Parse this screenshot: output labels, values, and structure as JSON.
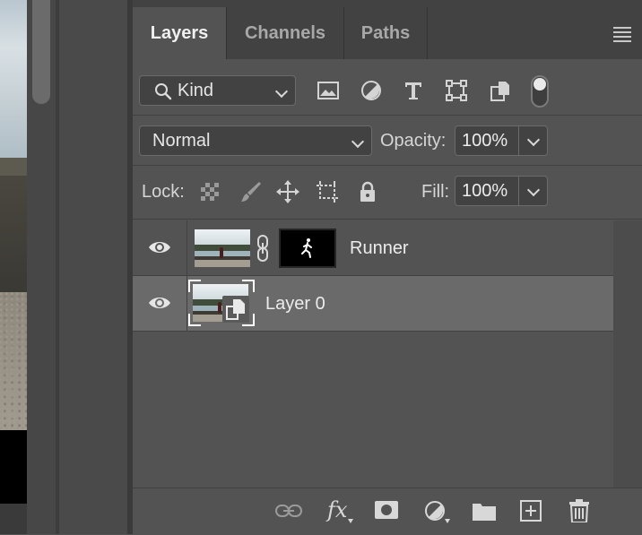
{
  "tabs": [
    {
      "label": "Layers",
      "active": true
    },
    {
      "label": "Channels",
      "active": false
    },
    {
      "label": "Paths",
      "active": false
    }
  ],
  "filter": {
    "kind_label": "Kind",
    "icons": [
      "image-filter-icon",
      "adjustment-filter-icon",
      "type-filter-icon",
      "shape-filter-icon",
      "smart-object-filter-icon"
    ],
    "toggle_on": true
  },
  "blend": {
    "mode": "Normal",
    "opacity_label": "Opacity:",
    "opacity_value": "100%"
  },
  "lock": {
    "label": "Lock:",
    "icons": [
      "lock-transparent-pixels-icon",
      "lock-image-pixels-icon",
      "lock-position-icon",
      "lock-artboard-icon",
      "lock-all-icon"
    ],
    "fill_label": "Fill:",
    "fill_value": "100%"
  },
  "layers": [
    {
      "name": "Runner",
      "visible": true,
      "has_mask": true,
      "selected": false,
      "smart_object": false
    },
    {
      "name": "Layer 0",
      "visible": true,
      "has_mask": false,
      "selected": true,
      "smart_object": true
    }
  ],
  "footer_icons": [
    "link-layers-icon",
    "fx-icon",
    "add-mask-icon",
    "adjustment-layer-icon",
    "new-group-icon",
    "new-layer-icon",
    "delete-icon"
  ],
  "footer": {
    "fx_label": "fx"
  },
  "colors": {
    "panel_bg": "#535353",
    "tab_bar_bg": "#424242",
    "selected_row_bg": "#6a6a6a",
    "text": "#d6d6d6"
  }
}
